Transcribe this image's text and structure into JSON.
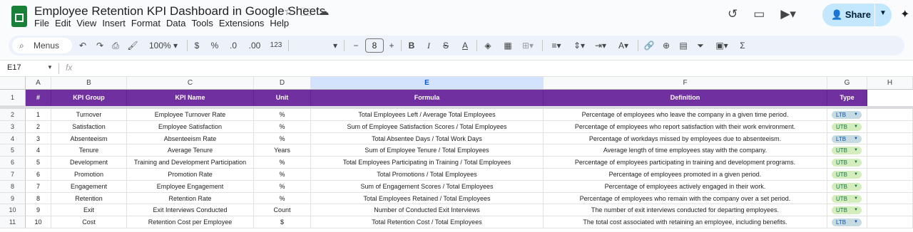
{
  "app": {
    "doc_title": "Employee Retention KPI Dashboard in Google Sheets",
    "menu": [
      "File",
      "Edit",
      "View",
      "Insert",
      "Format",
      "Data",
      "Tools",
      "Extensions",
      "Help"
    ],
    "share_label": "Share"
  },
  "toolbar": {
    "menus_label": "Menus",
    "zoom": "100%",
    "currency": "$",
    "percent": "%",
    "dec_decrease": ".0",
    "dec_increase": ".00",
    "more_formats": "123",
    "font_size": "8",
    "minus": "−",
    "plus": "+",
    "bold": "B",
    "italic": "I",
    "strike": "S",
    "text_color": "A",
    "sum": "Σ"
  },
  "formula_bar": {
    "cell_ref": "E17",
    "fx": "fx",
    "value": ""
  },
  "columns": [
    "A",
    "B",
    "C",
    "D",
    "E",
    "F",
    "G",
    "H"
  ],
  "selected_column": "E",
  "header_row": {
    "row_number": "1",
    "cells": [
      "#",
      "KPI Group",
      "KPI Name",
      "Unit",
      "Formula",
      "Definition",
      "Type"
    ]
  },
  "rows": [
    {
      "rn": "2",
      "num": "1",
      "group": "Turnover",
      "name": "Employee Turnover Rate",
      "unit": "%",
      "formula": "Total Employees Left / Average Total Employees",
      "definition": "Percentage of employees who leave the company in a given time period.",
      "type": "LTB"
    },
    {
      "rn": "3",
      "num": "2",
      "group": "Satisfaction",
      "name": "Employee Satisfaction",
      "unit": "%",
      "formula": "Sum of Employee Satisfaction Scores / Total Employees",
      "definition": "Percentage of employees who report satisfaction with their work environment.",
      "type": "UTB"
    },
    {
      "rn": "4",
      "num": "3",
      "group": "Absenteeism",
      "name": "Absenteeism Rate",
      "unit": "%",
      "formula": "Total Absentee Days / Total Work Days",
      "definition": "Percentage of workdays missed by employees due to absenteeism.",
      "type": "LTB"
    },
    {
      "rn": "5",
      "num": "4",
      "group": "Tenure",
      "name": "Average Tenure",
      "unit": "Years",
      "formula": "Sum of Employee Tenure / Total Employees",
      "definition": "Average length of time employees stay with the company.",
      "type": "UTB"
    },
    {
      "rn": "6",
      "num": "5",
      "group": "Development",
      "name": "Training and Development Participation",
      "unit": "%",
      "formula": "Total Employees Participating in Training / Total Employees",
      "definition": "Percentage of employees participating in training and development programs.",
      "type": "UTB"
    },
    {
      "rn": "7",
      "num": "6",
      "group": "Promotion",
      "name": "Promotion Rate",
      "unit": "%",
      "formula": "Total Promotions / Total Employees",
      "definition": "Percentage of employees promoted in a given period.",
      "type": "UTB"
    },
    {
      "rn": "8",
      "num": "7",
      "group": "Engagement",
      "name": "Employee Engagement",
      "unit": "%",
      "formula": "Sum of Engagement Scores / Total Employees",
      "definition": "Percentage of employees actively engaged in their work.",
      "type": "UTB"
    },
    {
      "rn": "9",
      "num": "8",
      "group": "Retention",
      "name": "Retention Rate",
      "unit": "%",
      "formula": "Total Employees Retained / Total Employees",
      "definition": "Percentage of employees who remain with the company over a set period.",
      "type": "UTB"
    },
    {
      "rn": "10",
      "num": "9",
      "group": "Exit",
      "name": "Exit Interviews Conducted",
      "unit": "Count",
      "formula": "Number of Conducted Exit Interviews",
      "definition": "The number of exit interviews conducted for departing employees.",
      "type": "UTB"
    },
    {
      "rn": "11",
      "num": "10",
      "group": "Cost",
      "name": "Retention Cost per Employee",
      "unit": "$",
      "formula": "Total Retention Cost / Total Employees",
      "definition": "The total cost associated with retaining an employee, including benefits.",
      "type": "LTB"
    }
  ],
  "colors": {
    "header_purple": "#7030a0",
    "ltb_chip": "#c6dbe1",
    "utb_chip": "#d4edbc",
    "share_button": "#c2e7ff",
    "selected_column": "#d3e3fd"
  }
}
